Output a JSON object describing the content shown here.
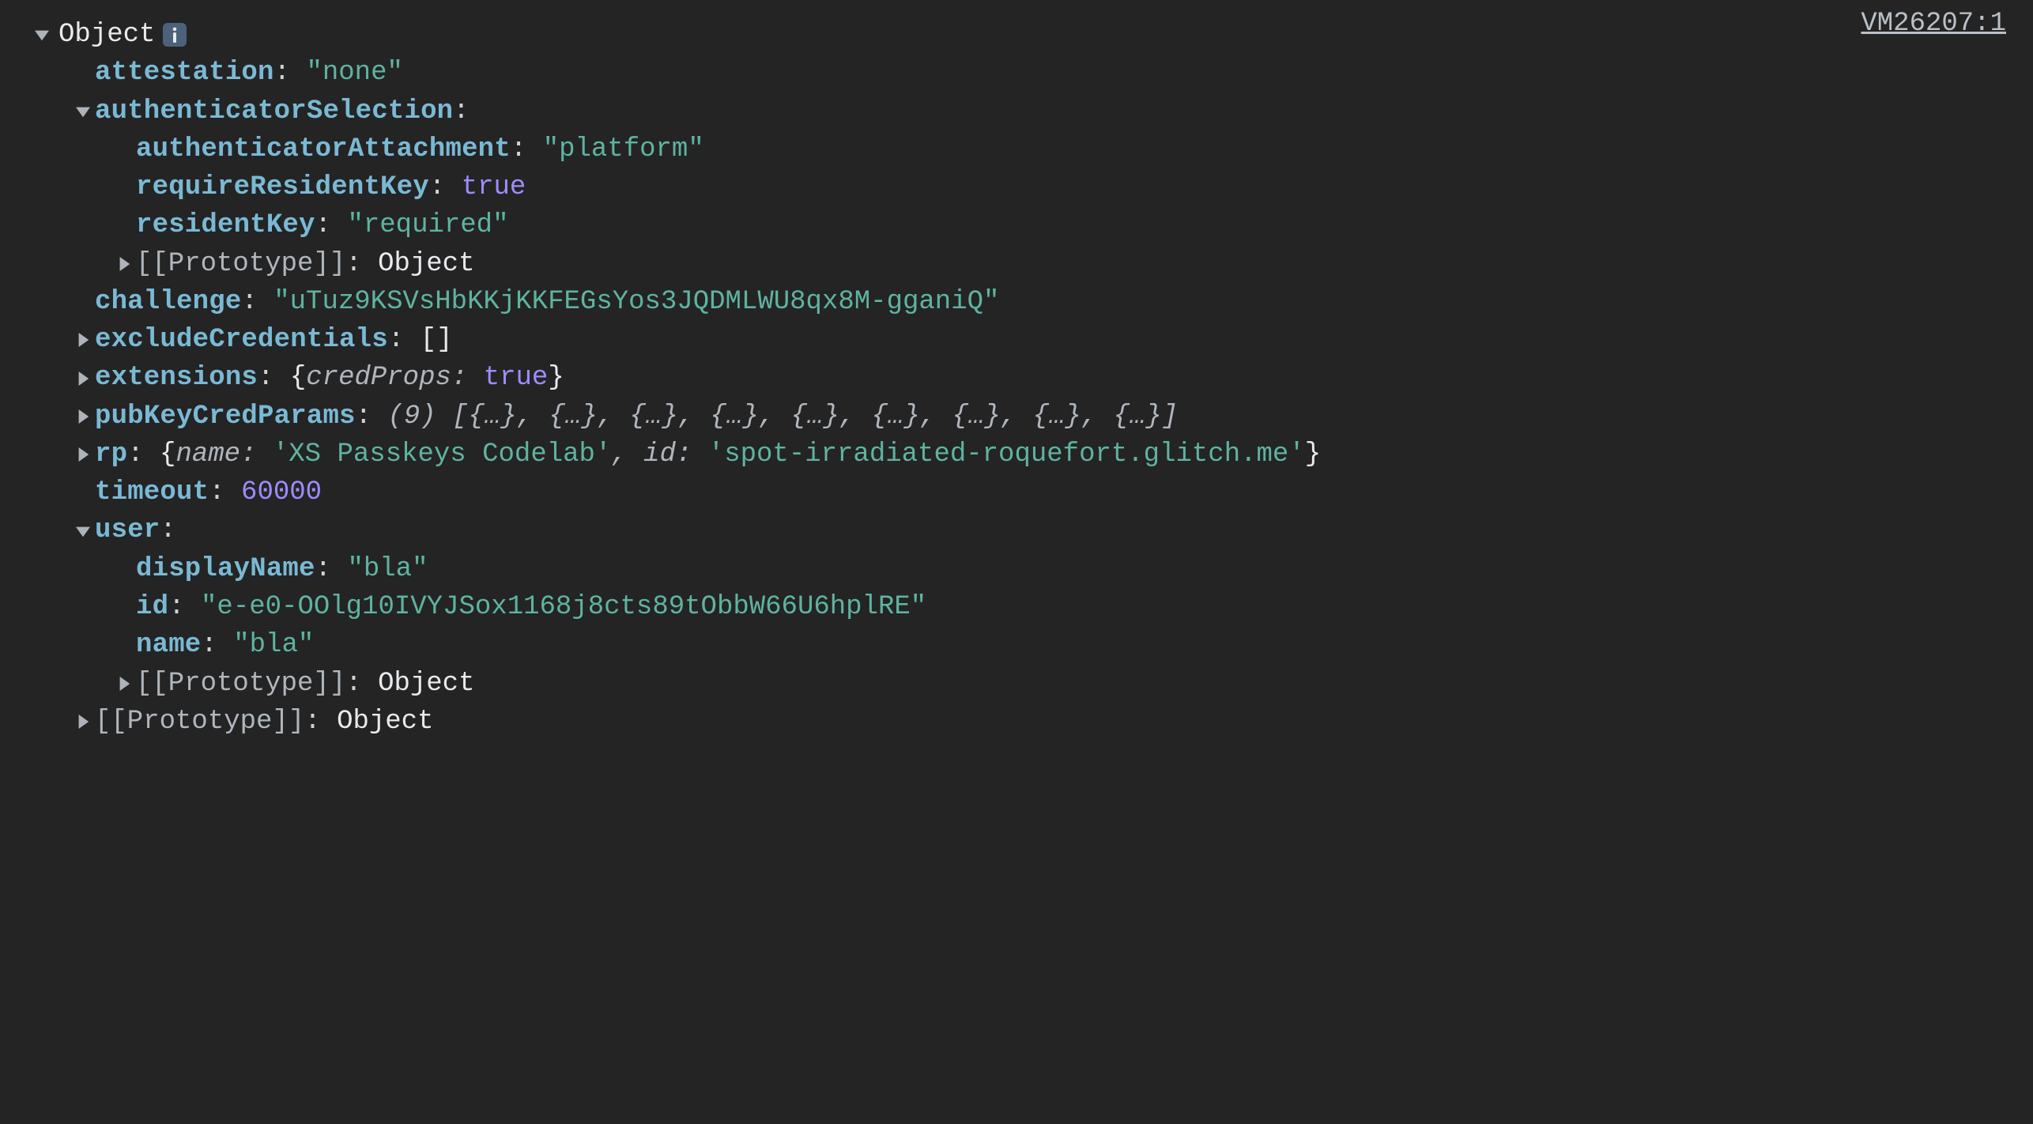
{
  "sourceLink": "VM26207:1",
  "rootLabel": "Object",
  "properties": {
    "attestation": {
      "key": "attestation",
      "value": "\"none\""
    },
    "authenticatorSelection": {
      "key": "authenticatorSelection",
      "authenticatorAttachment": {
        "key": "authenticatorAttachment",
        "value": "\"platform\""
      },
      "requireResidentKey": {
        "key": "requireResidentKey",
        "value": "true"
      },
      "residentKey": {
        "key": "residentKey",
        "value": "\"required\""
      },
      "prototype": {
        "key": "[[Prototype]]",
        "value": "Object"
      }
    },
    "challenge": {
      "key": "challenge",
      "value": "\"uTuz9KSVsHbKKjKKFEGsYos3JQDMLWU8qx8M-gganiQ\""
    },
    "excludeCredentials": {
      "key": "excludeCredentials",
      "value": "[]"
    },
    "extensions": {
      "key": "extensions",
      "preview_open": "{",
      "preview_key": "credProps",
      "preview_sep": ": ",
      "preview_val": "true",
      "preview_close": "}"
    },
    "pubKeyCredParams": {
      "key": "pubKeyCredParams",
      "count": "(9)",
      "previewArr": "[{…}, {…}, {…}, {…}, {…}, {…}, {…}, {…}, {…}]"
    },
    "rp": {
      "key": "rp",
      "preview_open": "{",
      "name_key": "name",
      "name_sep": ": ",
      "name_val": "'XS Passkeys Codelab'",
      "comma": ", ",
      "id_key": "id",
      "id_sep": ": ",
      "id_val": "'spot-irradiated-roquefort.glitch.me'",
      "preview_close": "}"
    },
    "timeout": {
      "key": "timeout",
      "value": "60000"
    },
    "user": {
      "key": "user",
      "displayName": {
        "key": "displayName",
        "value": "\"bla\""
      },
      "id": {
        "key": "id",
        "value": "\"e-e0-OOlg10IVYJSox1168j8cts89tObbW66U6hplRE\""
      },
      "name": {
        "key": "name",
        "value": "\"bla\""
      },
      "prototype": {
        "key": "[[Prototype]]",
        "value": "Object"
      }
    },
    "prototype": {
      "key": "[[Prototype]]",
      "value": "Object"
    }
  },
  "sep": ": "
}
